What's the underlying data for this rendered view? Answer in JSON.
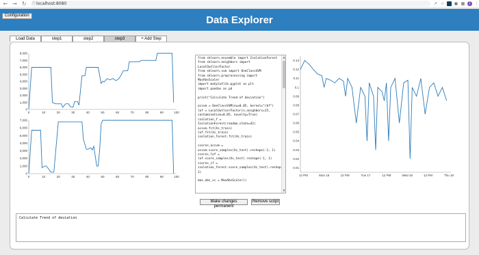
{
  "browser": {
    "url": "localhost:8080",
    "avatar_letter": "J"
  },
  "app": {
    "title": "Data Explorer",
    "config_label": "Configuration"
  },
  "tabs": [
    {
      "label": "Load Data",
      "active": false
    },
    {
      "label": "step1",
      "active": false
    },
    {
      "label": "step2",
      "active": false
    },
    {
      "label": "step3",
      "active": true
    },
    {
      "label": "+ Add Step",
      "active": false
    }
  ],
  "code_text": "from sklearn.ensemble import IsolationForest\nfrom sklearn.neighbors import LocalOutlierFactor\nfrom sklearn.svm import OneClassSVM\nfrom sklearn.preprocessing import MaxAbsScaler\nimport matplotlib.pyplot as plt\nimport pandas as pd\n\nprint(\"Calculate Trend of deviation\")\n\nocsvm = OneClassSVM(nu=0.05, kernel=\"rbf\")\nlof = LocalOutlierFactor(n_neighbors=15, contamination=0.05, novelty=True)\nisolation_f = IsolationForest(random_state=42)\nocsvm.fit(Xs_train)\nlof.fit(Xs_train)\nisolation_forest.fit(Xs_train)\n\nscores_ocsvm = ocsvm.score_samples(Xs_test).reshape(-1, 1)\nscores_lof = lof.score_samples(Xs_test).reshape(-1, 1)\nscores_if = isolation_forest.score_samples(Xs_test).reshape(-1, 1)\n\nmax_abs_sc = MaxAbsScaler()",
  "buttons": {
    "make_permanent": "Make changes permanent",
    "remove_script": "Remove script"
  },
  "notes_text": "Calculate Trend of deviation",
  "colors": {
    "line": "#2a7ab8",
    "header": "#2d7fc0"
  },
  "chart_data": [
    {
      "type": "line",
      "name": "top-left",
      "ylim": [
        0,
        8000
      ],
      "xlim": [
        0,
        100
      ],
      "yticks": [
        "0",
        "1,000",
        "2,000",
        "3,000",
        "4,000",
        "5,000",
        "6,000",
        "7,000",
        "8,000"
      ],
      "xticks": [
        "0",
        "10",
        "20",
        "30",
        "40",
        "50",
        "60",
        "70",
        "80",
        "90",
        "100"
      ],
      "x": [
        0,
        2,
        3,
        15,
        16,
        18,
        22,
        23,
        25,
        27,
        28,
        30,
        31,
        33,
        34,
        36,
        38,
        39,
        47,
        49,
        50,
        51,
        53,
        55,
        57,
        59,
        61,
        62,
        64,
        65,
        67,
        68,
        75,
        76,
        86,
        87,
        97,
        98
      ],
      "y": [
        0,
        6000,
        6000,
        6000,
        1000,
        800,
        800,
        300,
        800,
        800,
        400,
        300,
        1100,
        1100,
        600,
        4800,
        4800,
        6000,
        6000,
        3700,
        4000,
        3900,
        4400,
        4200,
        4400,
        4100,
        4400,
        4700,
        5500,
        5500,
        5500,
        6800,
        6800,
        7000,
        7000,
        8000,
        8000,
        1000
      ]
    },
    {
      "type": "line",
      "name": "bottom-left",
      "ylim": [
        0,
        7000
      ],
      "xlim": [
        0,
        100
      ],
      "yticks": [
        "0",
        "1,000",
        "2,000",
        "3,000",
        "4,000",
        "5,000",
        "6,000",
        "7,000"
      ],
      "xticks": [
        "0",
        "10",
        "20",
        "30",
        "40",
        "50",
        "60",
        "70",
        "80",
        "90",
        "100"
      ],
      "x": [
        0,
        2,
        3,
        8,
        9,
        11,
        12,
        15,
        17,
        20,
        21,
        24,
        25,
        27,
        28,
        36,
        37,
        39,
        40,
        42,
        43,
        44,
        46,
        47,
        48,
        49,
        50,
        51,
        97,
        98
      ],
      "y": [
        0,
        5700,
        5700,
        5700,
        800,
        1000,
        1000,
        200,
        200,
        6800,
        6800,
        6800,
        6800,
        6800,
        6800,
        6800,
        4500,
        3200,
        3200,
        3400,
        3100,
        3600,
        1000,
        1000,
        3200,
        6500,
        7000,
        7000,
        7000,
        0
      ]
    },
    {
      "type": "line",
      "name": "right",
      "ylim": [
        0.005,
        0.135
      ],
      "yticks": [
        "0.01",
        "0.02",
        "0.03",
        "0.04",
        "0.05",
        "0.06",
        "0.07",
        "0.08",
        "0.09",
        "0.1",
        "0.11",
        "0.12",
        "0.13"
      ],
      "xticks": [
        "12 PM",
        "Mon 16",
        "12 PM",
        "Tue 17",
        "12 PM",
        "Wed 18",
        "12 PM",
        "Thu 19"
      ],
      "xlim": [
        0,
        3.5
      ],
      "x": [
        0,
        0.05,
        0.1,
        0.15,
        0.2,
        0.3,
        0.4,
        0.5,
        0.55,
        0.6,
        0.7,
        0.8,
        0.9,
        1.0,
        1.05,
        1.1,
        1.2,
        1.3,
        1.4,
        1.5,
        1.55,
        1.6,
        1.7,
        1.75,
        1.8,
        1.9,
        1.95,
        2.0,
        2.05,
        2.1,
        2.2,
        2.3,
        2.4,
        2.5,
        2.55,
        2.6,
        2.7,
        2.8,
        2.9,
        3.0,
        3.1,
        3.2,
        3.3,
        3.4
      ],
      "y": [
        0.12,
        0.125,
        0.13,
        0.128,
        0.126,
        0.12,
        0.115,
        0.113,
        0.1,
        0.11,
        0.108,
        0.105,
        0.11,
        0.107,
        0.09,
        0.11,
        0.1,
        0.06,
        0.1,
        0.09,
        0.04,
        0.105,
        0.09,
        0.03,
        0.1,
        0.095,
        0.085,
        0.105,
        0.04,
        0.1,
        0.11,
        0.06,
        0.105,
        0.108,
        0.02,
        0.1,
        0.09,
        0.11,
        0.07,
        0.1,
        0.105,
        0.09,
        0.1,
        0.085
      ]
    }
  ]
}
